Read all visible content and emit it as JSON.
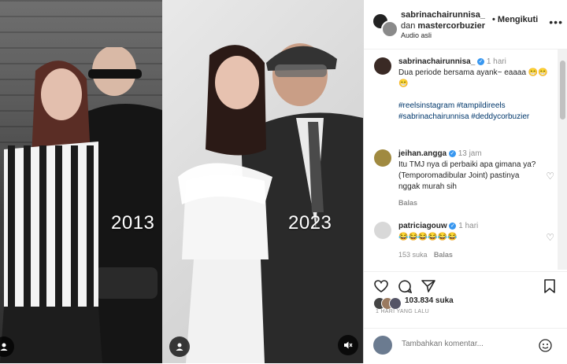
{
  "post": {
    "left_year": "2013",
    "right_year": "2023"
  },
  "header": {
    "author": "sabrinachairunnisa_",
    "and_text": "dan",
    "coauthor": "mastercorbuzier",
    "follow_label": "• Mengikuti",
    "audio_label": "Audio asli",
    "more_icon": "more-horizontal-icon"
  },
  "caption": {
    "author": "sabrinachairunnisa_",
    "time": "1 hari",
    "text": "Dua periode bersama ayank~ eaaaa 😁😁😁",
    "hashtags": "#reelsinstagram #tampildireels #sabrinachairunnisa #deddycorbuzier"
  },
  "comments": [
    {
      "user": "jeihan.angga",
      "time": "13 jam",
      "text": "Itu TMJ nya di perbaiki apa gimana ya? (Temporomadibular Joint) pastinya nggak murah sih",
      "reply_label": "Balas"
    },
    {
      "user": "patriciagouw",
      "time": "1 hari",
      "text": "😂😂😂😂😂😂",
      "meta": "153 suka",
      "reply_label": "Balas"
    }
  ],
  "actions": {
    "likes_text": "103.834 suka",
    "date_text": "1 HARI YANG LALU"
  },
  "comment_input": {
    "placeholder": "Tambahkan komentar..."
  },
  "colors": {
    "verified": "#3897f0",
    "link": "#00376b",
    "muted": "#8e8e8e"
  }
}
